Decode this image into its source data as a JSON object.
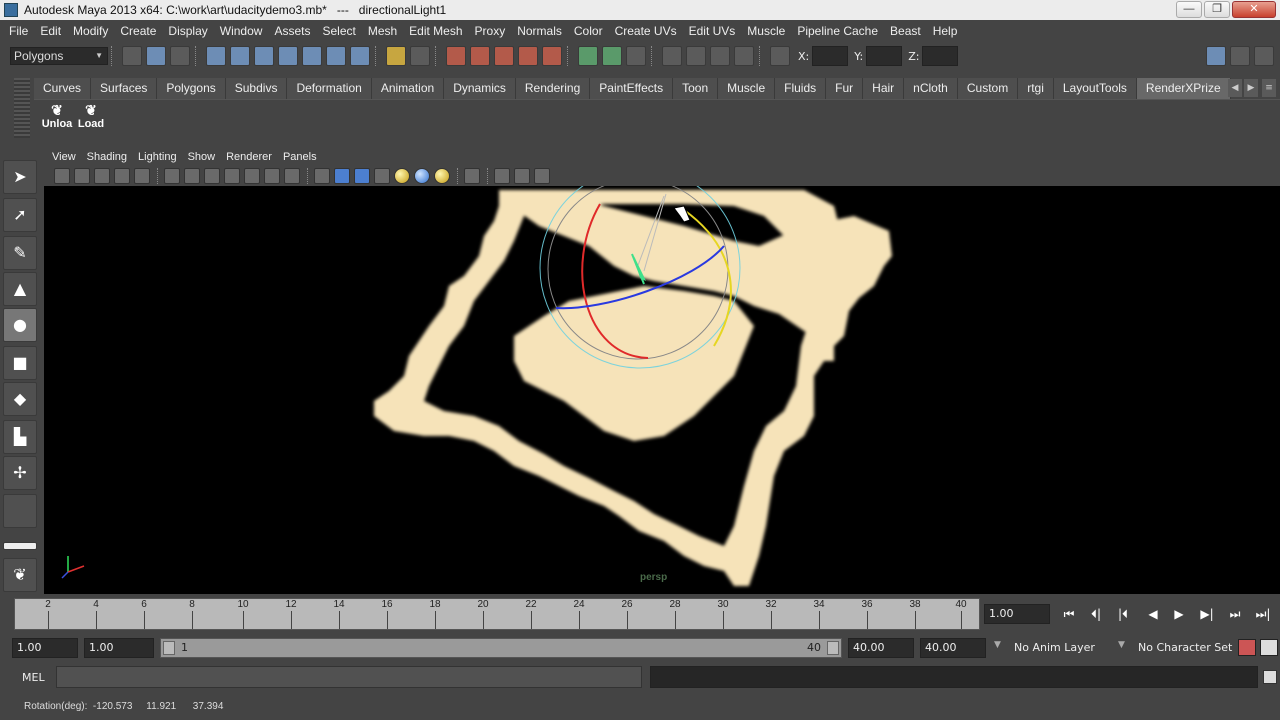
{
  "window": {
    "title": "Autodesk Maya 2013 x64: C:\\work\\art\\udacitydemo3.mb*   ---   directionalLight1",
    "minimize": "—",
    "maximize": "❐",
    "close": "✕"
  },
  "menubar": {
    "items": [
      "File",
      "Edit",
      "Modify",
      "Create",
      "Display",
      "Window",
      "Assets",
      "Select",
      "Mesh",
      "Edit Mesh",
      "Proxy",
      "Normals",
      "Color",
      "Create UVs",
      "Edit UVs",
      "Muscle",
      "Pipeline Cache",
      "Beast",
      "Help"
    ]
  },
  "statusline": {
    "mode": "Polygons",
    "x_label": "X:",
    "y_label": "Y:",
    "z_label": "Z:"
  },
  "shelf": {
    "tabs": [
      "Curves",
      "Surfaces",
      "Polygons",
      "Subdivs",
      "Deformation",
      "Animation",
      "Dynamics",
      "Rendering",
      "PaintEffects",
      "Toon",
      "Muscle",
      "Fluids",
      "Fur",
      "Hair",
      "nCloth",
      "Custom",
      "rtgi",
      "LayoutTools",
      "RenderXPrize"
    ],
    "active_tab": "RenderXPrize",
    "buttons": [
      {
        "label": "Unloa",
        "icon": "unload-plugin-icon"
      },
      {
        "label": "Load",
        "icon": "load-plugin-icon"
      }
    ]
  },
  "viewport": {
    "menus": [
      "View",
      "Shading",
      "Lighting",
      "Show",
      "Renderer",
      "Panels"
    ],
    "camera_label": "persp"
  },
  "timeslider": {
    "ticks": [
      "2",
      "4",
      "6",
      "8",
      "10",
      "12",
      "14",
      "16",
      "18",
      "20",
      "22",
      "24",
      "26",
      "28",
      "30",
      "32",
      "34",
      "36",
      "38",
      "40"
    ],
    "current_frame": "1.00",
    "controls": [
      "⏮",
      "⏴|",
      "|⏴",
      "◀",
      "▶",
      "▶|",
      "⏭",
      "⏭|"
    ]
  },
  "rangeslider": {
    "start_time": "1.00",
    "playback_start": "1.00",
    "range_start": "1",
    "range_end": "40",
    "playback_end": "40.00",
    "end_time": "40.00",
    "anim_layer": "No Anim Layer",
    "character_set": "No Character Set"
  },
  "cmdline": {
    "label": "MEL"
  },
  "helpline": {
    "text": "Rotation(deg):  -120.573     11.921      37.394"
  }
}
